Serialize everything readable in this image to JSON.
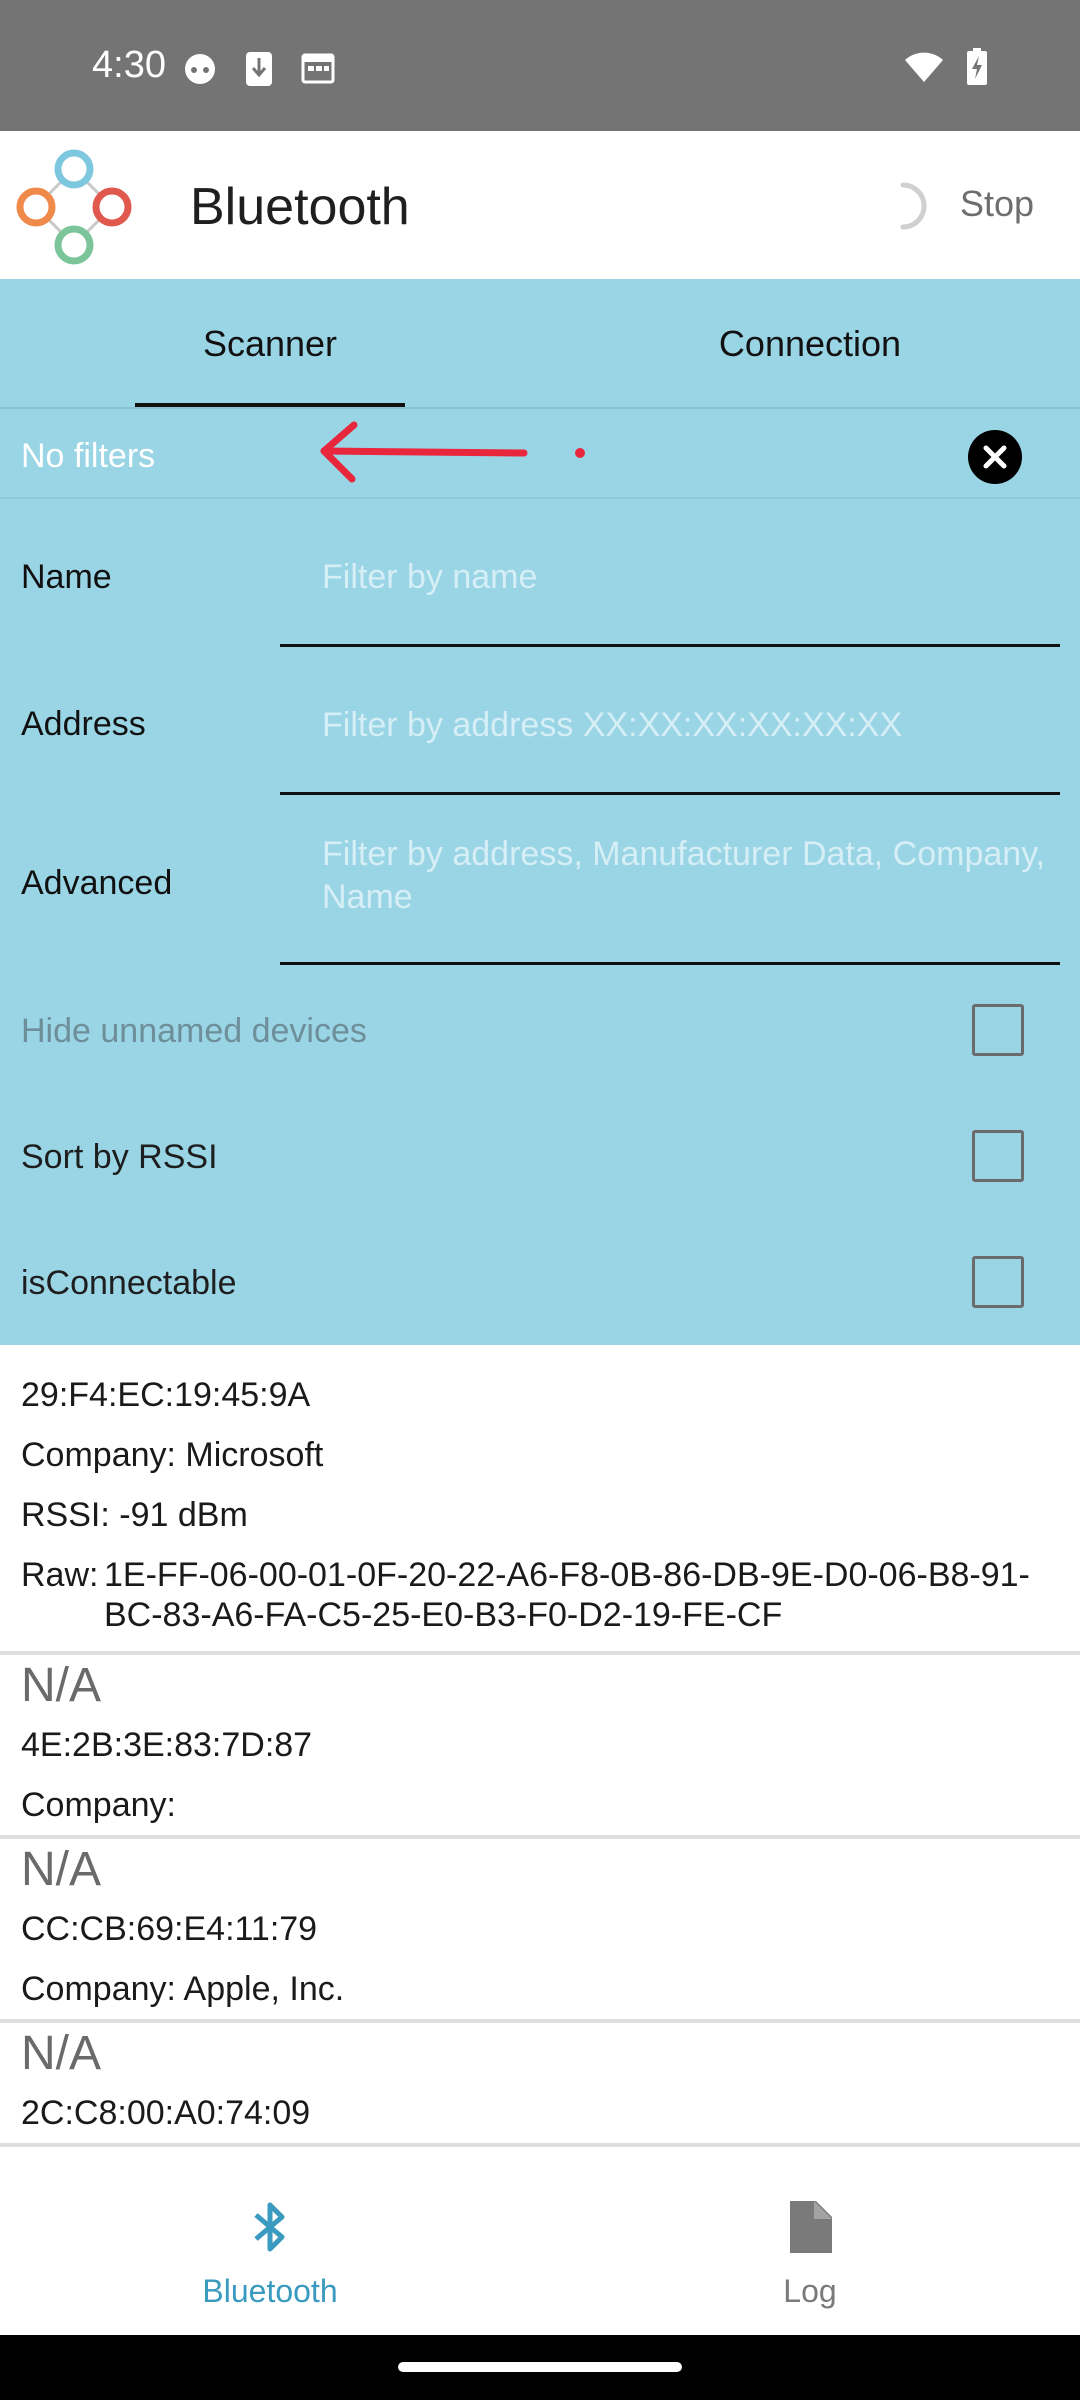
{
  "status_bar": {
    "time": "4:30"
  },
  "app_bar": {
    "title": "Bluetooth",
    "stop_label": "Stop"
  },
  "tabs": [
    {
      "label": "Scanner",
      "selected": true
    },
    {
      "label": "Connection",
      "selected": false
    }
  ],
  "filters": {
    "summary": "No filters",
    "name": {
      "label": "Name",
      "placeholder": "Filter by name",
      "value": ""
    },
    "address": {
      "label": "Address",
      "placeholder": "Filter by address XX:XX:XX:XX:XX:XX",
      "value": ""
    },
    "advanced": {
      "label": "Advanced",
      "placeholder": "Filter by address, Manufacturer Data, Company, Name",
      "value": ""
    },
    "hide_unnamed": {
      "label": "Hide unnamed devices",
      "checked": false
    },
    "sort_rssi": {
      "label": "Sort by RSSI",
      "checked": false
    },
    "is_connectable": {
      "label": "isConnectable",
      "checked": false
    }
  },
  "devices": [
    {
      "address": "29:F4:EC:19:45:9A",
      "company_label": "Company:",
      "company": "Microsoft",
      "rssi_label": "RSSI:",
      "rssi": "-91 dBm",
      "raw_label": "Raw:",
      "raw": "1E-FF-06-00-01-0F-20-22-A6-F8-0B-86-DB-9E-D0-06-B8-91-BC-83-A6-FA-C5-25-E0-B3-F0-D2-19-FE-CF"
    },
    {
      "name": "N/A",
      "address": "4E:2B:3E:83:7D:87",
      "company_label": "Company:",
      "company": ""
    },
    {
      "name": "N/A",
      "address": "CC:CB:69:E4:11:79",
      "company_label": "Company:",
      "company": "Apple, Inc."
    },
    {
      "name": "N/A",
      "address": "2C:C8:00:A0:74:09"
    }
  ],
  "bottom_nav": [
    {
      "label": "Bluetooth",
      "icon": "bluetooth-icon",
      "active": true
    },
    {
      "label": "Log",
      "icon": "file-icon",
      "active": false
    }
  ],
  "colors": {
    "panel": "#9ad5e6",
    "accent": "#3a9ac0",
    "annotation": "#e8273c"
  }
}
